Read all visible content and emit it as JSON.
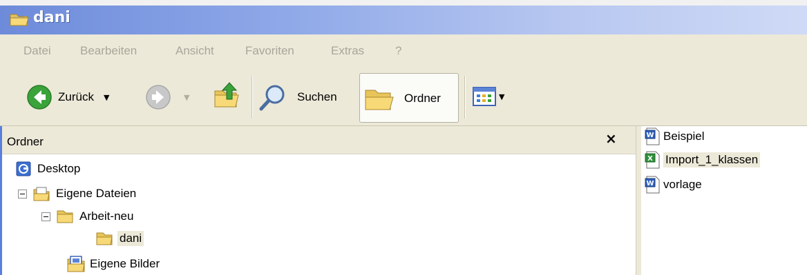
{
  "window": {
    "title": "dani"
  },
  "menu": [
    "Datei",
    "Bearbeiten",
    "Ansicht",
    "Favoriten",
    "Extras",
    "?"
  ],
  "toolbar": {
    "back_label": "Zurück",
    "search_label": "Suchen",
    "folders_label": "Ordner"
  },
  "folder_pane": {
    "title": "Ordner",
    "close": "×",
    "tree": [
      {
        "label": "Desktop",
        "icon": "desktop-icon"
      },
      {
        "label": "Eigene Dateien",
        "icon": "my-documents-icon",
        "expanded": true
      },
      {
        "label": "Arbeit-neu",
        "icon": "folder-icon",
        "expanded": true
      },
      {
        "label": "dani",
        "icon": "folder-open-icon",
        "selected": true
      },
      {
        "label": "Eigene Bilder",
        "icon": "my-pictures-icon"
      }
    ]
  },
  "files": [
    {
      "name": "Beispiel",
      "icon": "word-doc-icon"
    },
    {
      "name": "Import_1_klassen",
      "icon": "excel-doc-icon",
      "selected": true
    },
    {
      "name": "vorlage",
      "icon": "word-doc-icon"
    }
  ]
}
